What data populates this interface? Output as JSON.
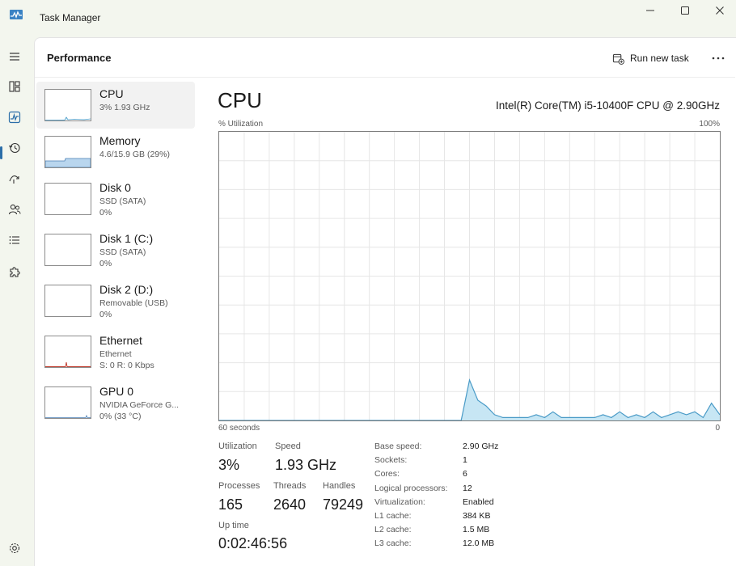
{
  "window": {
    "title": "Task Manager"
  },
  "header": {
    "page_title": "Performance",
    "run_new_task": "Run new task"
  },
  "devices": [
    {
      "name": "CPU",
      "sub1": "3%  1.93 GHz",
      "sub2": ""
    },
    {
      "name": "Memory",
      "sub1": "4.6/15.9 GB (29%)",
      "sub2": ""
    },
    {
      "name": "Disk 0",
      "sub1": "SSD (SATA)",
      "sub2": "0%"
    },
    {
      "name": "Disk 1 (C:)",
      "sub1": "SSD (SATA)",
      "sub2": "0%"
    },
    {
      "name": "Disk 2 (D:)",
      "sub1": "Removable (USB)",
      "sub2": "0%"
    },
    {
      "name": "Ethernet",
      "sub1": "Ethernet",
      "sub2": "S: 0 R: 0 Kbps"
    },
    {
      "name": "GPU 0",
      "sub1": "NVIDIA GeForce G...",
      "sub2": "0% (33 °C)"
    }
  ],
  "cpu": {
    "title": "CPU",
    "model": "Intel(R) Core(TM) i5-10400F CPU @ 2.90GHz",
    "y_label": "% Utilization",
    "y_max_label": "100%",
    "x_left_label": "60 seconds",
    "x_right_label": "0"
  },
  "chart_data": {
    "type": "area",
    "x_range": [
      60,
      0
    ],
    "ylim": [
      0,
      100
    ],
    "grid": true,
    "x": [
      60,
      59,
      58,
      57,
      56,
      55,
      54,
      53,
      52,
      51,
      50,
      49,
      48,
      47,
      46,
      45,
      44,
      43,
      42,
      41,
      40,
      39,
      38,
      37,
      36,
      35,
      34,
      33,
      32,
      31,
      30,
      29,
      28,
      27,
      26,
      25,
      24,
      23,
      22,
      21,
      20,
      19,
      18,
      17,
      16,
      15,
      14,
      13,
      12,
      11,
      10,
      9,
      8,
      7,
      6,
      5,
      4,
      3,
      2,
      1,
      0
    ],
    "values": [
      0,
      0,
      0,
      0,
      0,
      0,
      0,
      0,
      0,
      0,
      0,
      0,
      0,
      0,
      0,
      0,
      0,
      0,
      0,
      0,
      0,
      0,
      0,
      0,
      0,
      0,
      0,
      0,
      0,
      0,
      14,
      7,
      5,
      2,
      1,
      1,
      1,
      1,
      2,
      1,
      3,
      1,
      1,
      1,
      1,
      1,
      2,
      1,
      3,
      1,
      2,
      1,
      3,
      1,
      2,
      3,
      2,
      3,
      1,
      6,
      2
    ]
  },
  "stats": {
    "utilization_label": "Utilization",
    "utilization_value": "3%",
    "speed_label": "Speed",
    "speed_value": "1.93 GHz",
    "processes_label": "Processes",
    "processes_value": "165",
    "threads_label": "Threads",
    "threads_value": "2640",
    "handles_label": "Handles",
    "handles_value": "79249",
    "uptime_label": "Up time",
    "uptime_value": "0:02:46:56"
  },
  "specs": [
    {
      "label": "Base speed:",
      "value": "2.90 GHz"
    },
    {
      "label": "Sockets:",
      "value": "1"
    },
    {
      "label": "Cores:",
      "value": "6"
    },
    {
      "label": "Logical processors:",
      "value": "12"
    },
    {
      "label": "Virtualization:",
      "value": "Enabled"
    },
    {
      "label": "L1 cache:",
      "value": "384 KB"
    },
    {
      "label": "L2 cache:",
      "value": "1.5 MB"
    },
    {
      "label": "L3 cache:",
      "value": "12.0 MB"
    }
  ],
  "icons": {
    "app": "task-manager-icon",
    "minimize": "minimize-icon",
    "maximize": "maximize-icon",
    "close": "close-icon",
    "menu": "hamburger-menu-icon",
    "processes": "processes-icon",
    "performance": "performance-icon",
    "app_history": "history-icon",
    "startup": "startup-icon",
    "users": "users-icon",
    "details": "details-list-icon",
    "services": "services-puzzle-icon",
    "settings": "settings-gear-icon",
    "run_task": "run-task-icon",
    "more": "more-options-icon"
  },
  "colors": {
    "chart_line": "#4a9bc7",
    "chart_fill": "#c7e6f4",
    "grid": "#e6e6e6",
    "memory_fill": "#b9d6ee",
    "ethernet_spike": "#c0392b",
    "accent": "#2b6ea8"
  }
}
